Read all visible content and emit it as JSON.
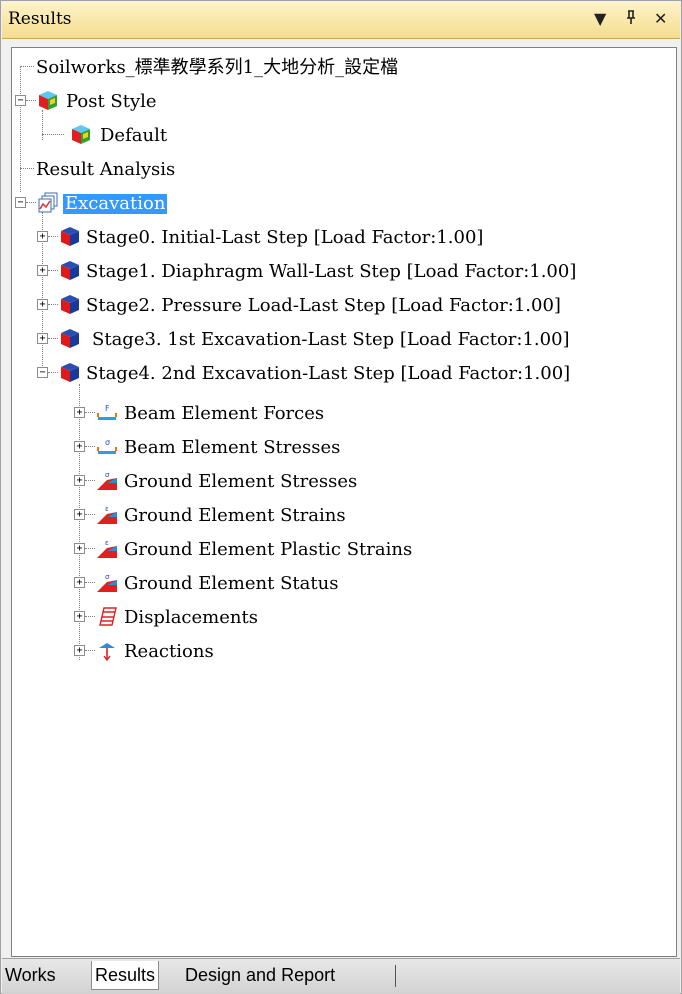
{
  "panel": {
    "title": "Results",
    "controls": {
      "dropdown": "▼",
      "pin": "ᵖ",
      "close": "✕"
    }
  },
  "tree": {
    "root_label": "Soilworks_標準教學系列1_大地分析_設定檔",
    "post_style": {
      "label": "Post Style",
      "children": [
        "Default"
      ]
    },
    "result_analysis": "Result Analysis",
    "excavation": {
      "label": "Excavation",
      "stages": [
        "Stage0. Initial-Last Step [Load Factor:1.00]",
        "Stage1. Diaphragm Wall-Last Step [Load Factor:1.00]",
        "Stage2. Pressure Load-Last Step [Load Factor:1.00]",
        "Stage3. 1st Excavation-Last Step [Load Factor:1.00]",
        "Stage4. 2nd Excavation-Last Step [Load Factor:1.00]"
      ],
      "stage4_children": [
        "Beam Element Forces",
        "Beam Element Stresses",
        "Ground Element Stresses",
        "Ground Element Strains",
        "Ground Element Plastic Strains",
        "Ground Element Status",
        "Displacements",
        "Reactions"
      ]
    }
  },
  "tabs": [
    "Works",
    "Results",
    "Design and Report"
  ],
  "colors": {
    "selection": "#3399ff",
    "titlebar": "#f5dd8f"
  }
}
